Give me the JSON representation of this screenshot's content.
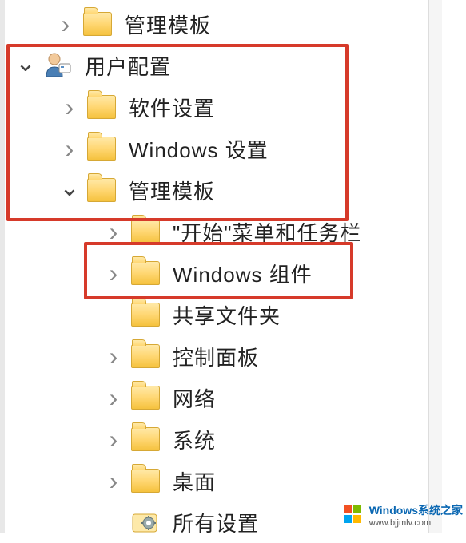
{
  "tree": {
    "items": [
      {
        "label": "管理模板",
        "expanded": false,
        "depth": "indent-0",
        "icon": "folder",
        "hasChevron": true
      },
      {
        "label": "用户配置",
        "expanded": true,
        "depth": "indent-root",
        "icon": "user",
        "hasChevron": true
      },
      {
        "label": "软件设置",
        "expanded": false,
        "depth": "indent-1",
        "icon": "folder",
        "hasChevron": true
      },
      {
        "label": "Windows 设置",
        "expanded": false,
        "depth": "indent-1",
        "icon": "folder",
        "hasChevron": true
      },
      {
        "label": "管理模板",
        "expanded": true,
        "depth": "indent-1",
        "icon": "folder",
        "hasChevron": true
      },
      {
        "label": "\"开始\"菜单和任务栏",
        "expanded": false,
        "depth": "indent-2",
        "icon": "folder",
        "hasChevron": true
      },
      {
        "label": "Windows 组件",
        "expanded": false,
        "depth": "indent-2",
        "icon": "folder",
        "hasChevron": true
      },
      {
        "label": "共享文件夹",
        "expanded": false,
        "depth": "indent-2",
        "icon": "folder",
        "hasChevron": false
      },
      {
        "label": "控制面板",
        "expanded": false,
        "depth": "indent-2",
        "icon": "folder",
        "hasChevron": true
      },
      {
        "label": "网络",
        "expanded": false,
        "depth": "indent-2",
        "icon": "folder",
        "hasChevron": true
      },
      {
        "label": "系统",
        "expanded": false,
        "depth": "indent-2",
        "icon": "folder",
        "hasChevron": true
      },
      {
        "label": "桌面",
        "expanded": false,
        "depth": "indent-2",
        "icon": "folder",
        "hasChevron": true
      },
      {
        "label": "所有设置",
        "expanded": false,
        "depth": "indent-2",
        "icon": "gear",
        "hasChevron": false
      }
    ]
  },
  "watermark": {
    "main": "Windows系统之家",
    "url": "www.bjjmlv.com"
  }
}
